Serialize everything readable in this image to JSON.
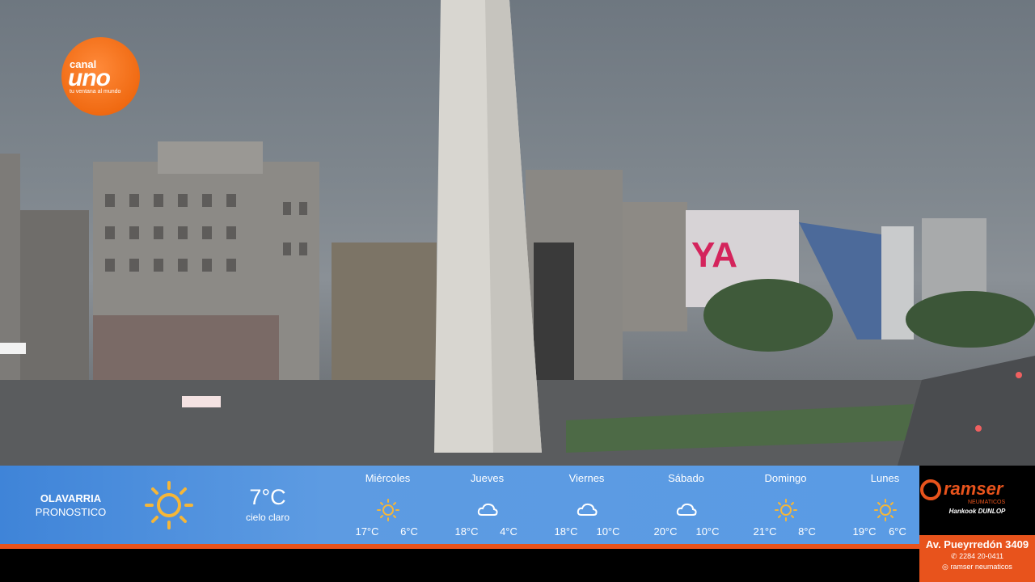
{
  "logo": {
    "line1": "canal",
    "line2": "uno",
    "tagline": "tu ventana al mundo"
  },
  "current": {
    "city": "OLAVARRIA",
    "subtitle": "PRONOSTICO",
    "icon": "sun-icon",
    "temp": "7°C",
    "desc": "cielo claro"
  },
  "forecast": [
    {
      "day": "Miércoles",
      "icon": "sun-icon",
      "max": "17°C",
      "min": "6°C"
    },
    {
      "day": "Jueves",
      "icon": "cloud-icon",
      "max": "18°C",
      "min": "4°C"
    },
    {
      "day": "Viernes",
      "icon": "cloud-icon",
      "max": "18°C",
      "min": "10°C"
    },
    {
      "day": "Sábado",
      "icon": "cloud-icon",
      "max": "20°C",
      "min": "10°C"
    },
    {
      "day": "Domingo",
      "icon": "sun-icon",
      "max": "21°C",
      "min": "8°C"
    },
    {
      "day": "Lunes",
      "icon": "sun-icon",
      "max": "19°C",
      "min": "6°C"
    }
  ],
  "sponsor": {
    "brand": "ramser",
    "brand_sub": "NEUMATICOS",
    "partners": "Hankook  DUNLOP",
    "address": "Av. Pueyrredón 3409",
    "phone": "2284 20-0411",
    "social": "ramser neumaticos"
  },
  "colors": {
    "bar": "#5a9be4",
    "accent": "#e8531c",
    "sun": "#f5b638"
  }
}
